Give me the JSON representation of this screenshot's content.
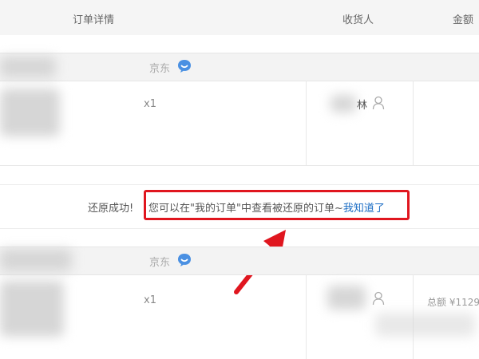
{
  "header": {
    "order_detail": "订单详情",
    "consignee": "收货人",
    "amount": "金额"
  },
  "orders": [
    {
      "shop": "京东",
      "qty": "x1",
      "consignee_name": "林"
    },
    {
      "shop": "京东",
      "qty": "x1",
      "total_label": "总额 ¥1129"
    }
  ],
  "notice": {
    "success_text": "还原成功!",
    "message": "您可以在\"我的订单\"中查看被还原的订单~",
    "link_text": "我知道了"
  },
  "colors": {
    "highlight": "#e0161f",
    "link": "#1a6cc4",
    "chat_icon": "#4a90e2"
  }
}
